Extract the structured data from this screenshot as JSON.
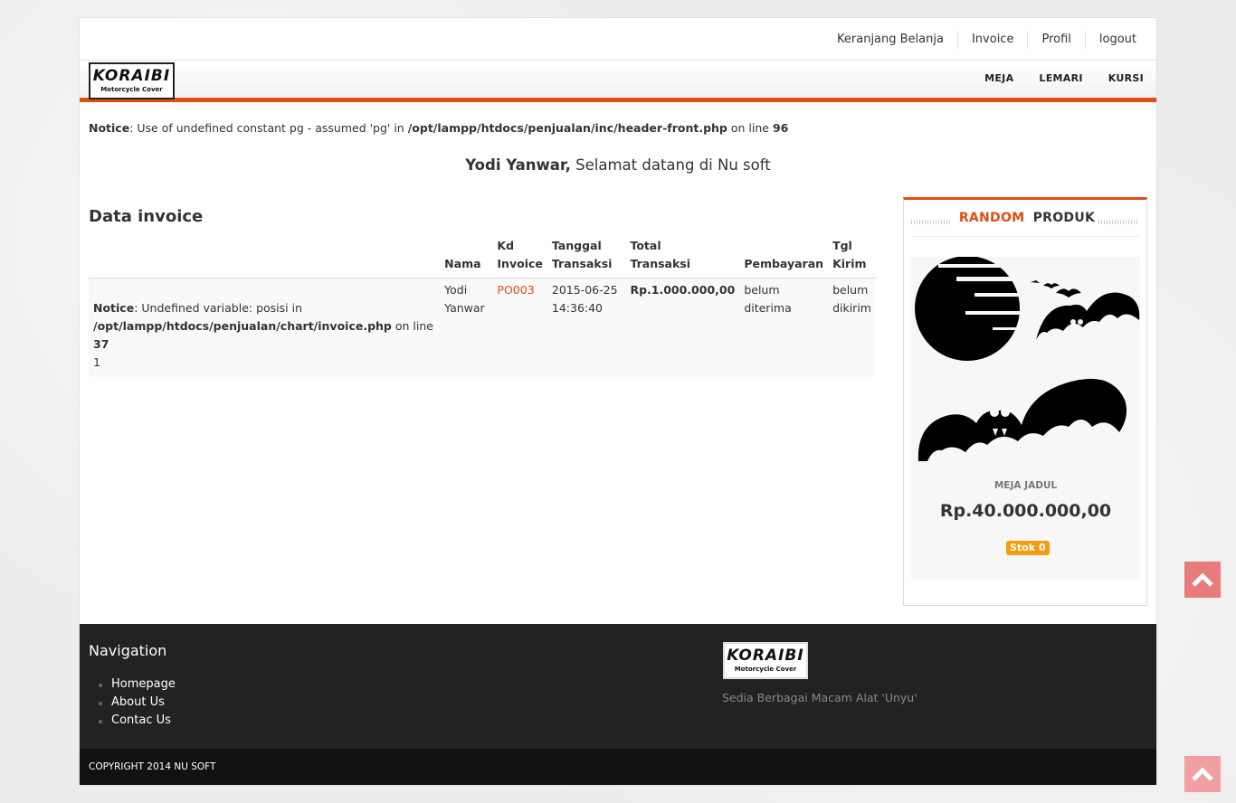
{
  "topnav": {
    "cart": "Keranjang Belanja",
    "invoice": "Invoice",
    "profile": "Profil",
    "logout": "logout"
  },
  "logo": {
    "name": "KORAIBI",
    "tagline": "Motorcycle Cover"
  },
  "mainnav": {
    "meja": "MEJA",
    "lemari": "LEMARI",
    "kursi": "KURSI"
  },
  "notice1": {
    "label": "Notice",
    "text": ": Use of undefined constant pg - assumed 'pg' in ",
    "path": "/opt/lampp/htdocs/penjualan/inc/header-front.php",
    "online": " on line ",
    "line": "96"
  },
  "welcome": {
    "name": "Yodi Yanwar,",
    "text": " Selamat datang di Nu soft"
  },
  "invoice": {
    "heading": "Data invoice",
    "headers": {
      "nama": "Nama",
      "kd_a": "Kd",
      "kd_b": "Invoice",
      "tgl_a": "Tanggal",
      "tgl_b": "Transaksi",
      "total_a": "Total",
      "total_b": "Transaksi",
      "bayar": "Pembayaran",
      "kirim_a": "Tgl",
      "kirim_b": "Kirim"
    },
    "row": {
      "notice_label": "Notice",
      "notice_text": ": Undefined variable: posisi in",
      "notice_path": "/opt/lampp/htdocs/penjualan/chart/invoice.php",
      "notice_online": " on line ",
      "notice_line": "37",
      "num": "1",
      "nama_a": "Yodi",
      "nama_b": "Yanwar",
      "kd": "PO003",
      "date": "2015-06-25",
      "time": "14:36:40",
      "total": "Rp.1.000.000,00",
      "bayar_a": "belum",
      "bayar_b": "diterima",
      "kirim_a": "belum",
      "kirim_b": "dikirim"
    }
  },
  "sidebar": {
    "title_accent": "RANDOM",
    "title_rest": "PRODUK",
    "product": {
      "name": "MEJA JADUL",
      "price": "Rp.40.000.000,00",
      "stock": "Stok 0"
    }
  },
  "footer": {
    "nav_title": "Navigation",
    "links": [
      "Homepage",
      "About Us",
      "Contac Us"
    ],
    "tagline": "Sedia Berbagai Macam Alat 'Unyu'",
    "copyright": "COPYRIGHT 2014 NU SOFT"
  },
  "colors": {
    "accent": "#e24e12",
    "stock_badge": "#f39c12",
    "footer_bg": "#222222"
  }
}
